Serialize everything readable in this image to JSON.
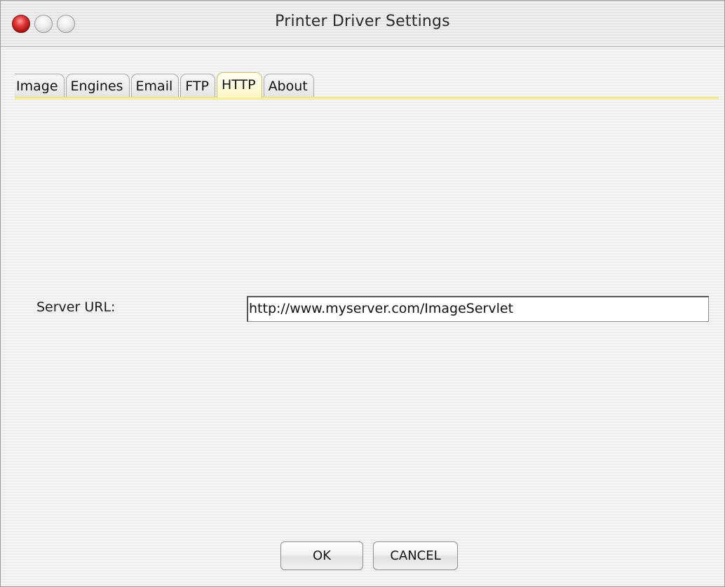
{
  "window": {
    "title": "Printer Driver Settings"
  },
  "tabs": [
    {
      "label": "Image",
      "active": false
    },
    {
      "label": "Engines",
      "active": false
    },
    {
      "label": "Email",
      "active": false
    },
    {
      "label": "FTP",
      "active": false
    },
    {
      "label": "HTTP",
      "active": true
    },
    {
      "label": "About",
      "active": false
    }
  ],
  "form": {
    "server_url_label": "Server URL:",
    "server_url_value": "http://www.myserver.com/ImageServlet"
  },
  "buttons": {
    "ok_label": "OK",
    "cancel_label": "CANCEL"
  },
  "colors": {
    "active_tab": "#fbf6c6",
    "close_button": "#e23a3a"
  }
}
